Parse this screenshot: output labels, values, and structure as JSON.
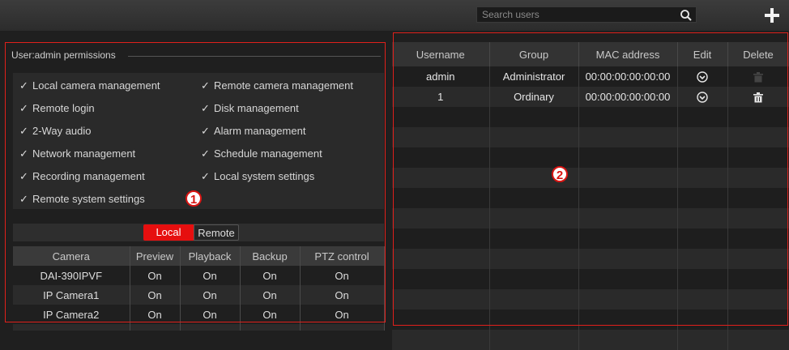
{
  "search": {
    "placeholder": "Search users"
  },
  "permissions": {
    "title": "User:admin permissions",
    "left_column": [
      "Local camera management",
      "Remote login",
      "2-Way audio",
      "Network management",
      "Recording management",
      "Remote system settings"
    ],
    "right_column": [
      "Remote camera management",
      "Disk management",
      "Alarm management",
      "Schedule management",
      "Local system settings"
    ]
  },
  "tabs": {
    "local": "Local",
    "remote": "Remote",
    "active": "Local"
  },
  "camera_table": {
    "headers": [
      "Camera",
      "Preview",
      "Playback",
      "Backup",
      "PTZ control"
    ],
    "rows": [
      [
        "DAI-390IPVF",
        "On",
        "On",
        "On",
        "On"
      ],
      [
        "IP Camera1",
        "On",
        "On",
        "On",
        "On"
      ],
      [
        "IP Camera2",
        "On",
        "On",
        "On",
        "On"
      ]
    ]
  },
  "user_table": {
    "headers": [
      "Username",
      "Group",
      "MAC address",
      "Edit",
      "Delete"
    ],
    "rows": [
      {
        "username": "admin",
        "group": "Administrator",
        "mac": "00:00:00:00:00:00",
        "delete_enabled": false
      },
      {
        "username": "1",
        "group": "Ordinary",
        "mac": "00:00:00:00:00:00",
        "delete_enabled": true
      }
    ]
  },
  "markers": {
    "left": "1",
    "right": "2"
  },
  "colors": {
    "accent": "#e60f0f",
    "annotation": "#e0201b"
  }
}
